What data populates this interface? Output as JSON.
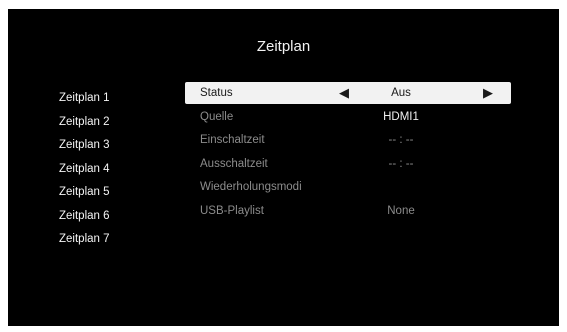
{
  "title": "Zeitplan",
  "schedules": [
    "Zeitplan 1",
    "Zeitplan 2",
    "Zeitplan 3",
    "Zeitplan 4",
    "Zeitplan 5",
    "Zeitplan 6",
    "Zeitplan 7"
  ],
  "settings": {
    "status": {
      "label": "Status",
      "value": "Aus",
      "left_arrow": "◀",
      "right_arrow": "▶"
    },
    "quelle": {
      "label": "Quelle",
      "value": "HDMI1"
    },
    "einschaltzeit": {
      "label": "Einschaltzeit",
      "value": "-- : --"
    },
    "ausschaltzeit": {
      "label": "Ausschaltzeit",
      "value": "-- : --"
    },
    "wiederholungsmodi": {
      "label": "Wiederholungsmodi"
    },
    "usb_playlist": {
      "label": "USB-Playlist",
      "value": "None"
    }
  },
  "colors": {
    "background": "#000000",
    "highlight": "#f2f2f2",
    "dim_text": "#8c8c8c"
  }
}
